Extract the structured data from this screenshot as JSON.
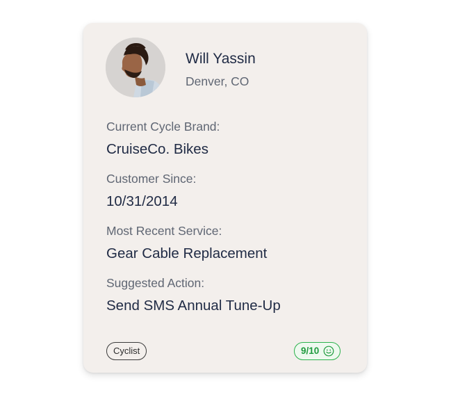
{
  "profile": {
    "name": "Will Yassin",
    "location": "Denver, CO",
    "avatar_icon": "person-photo"
  },
  "fields": [
    {
      "label": "Current Cycle Brand:",
      "value": "CruiseCo. Bikes"
    },
    {
      "label": "Customer Since:",
      "value": "10/31/2014"
    },
    {
      "label": "Most Recent Service:",
      "value": "Gear Cable Replacement"
    },
    {
      "label": "Suggested Action:",
      "value": "Send SMS Annual Tune-Up"
    }
  ],
  "footer": {
    "tag_label": "Cyclist",
    "score_label": "9/10",
    "score_icon": "smiley-face-icon",
    "score_color": "#2bb24c"
  },
  "colors": {
    "card_bg": "#f3efec",
    "text_primary": "#1f2a44",
    "text_secondary": "#5f6673"
  }
}
